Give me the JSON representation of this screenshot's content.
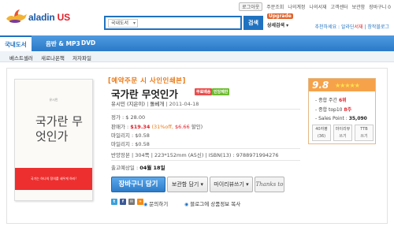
{
  "header": {
    "logo_brand": "aladin",
    "logo_us": "US",
    "top_links": [
      "로그아웃",
      "주문조회",
      "나의계정",
      "나의서재",
      "고객센터",
      "보관함",
      "장바구니 0"
    ],
    "search": {
      "category": "국내도서",
      "value": "",
      "button_label": "검색",
      "upgrade_label": "Upgrade",
      "detail_label": "상세검색 ▾"
    },
    "recommend_prefix": "추천하세요 : 알라딘",
    "recommend_highlight": "서재",
    "recommend_suffix": " | 창작블로그"
  },
  "nav": {
    "tabs": [
      "국내도서",
      "음반 & MP3",
      "DVD"
    ],
    "active_tab": "국내도서",
    "sub_items": [
      "베스트셀러",
      "새로나온책",
      "저자파일"
    ]
  },
  "book": {
    "preorder_label": "[예약주문 시 사인인쇄본]",
    "title": "국가란 무엇인가",
    "badges": [
      "무료배송",
      "인당제한"
    ],
    "author": "유시민 (지은이)",
    "publisher": "돌베개",
    "date": "2011-04-18",
    "cover_author": "유시민",
    "cover_title": "국가란 무엇인가",
    "cover_band_text": "국가는 하나의 정의를 세우게 하라!",
    "list_price_label": "정가 : ",
    "list_price": "$ 28.00",
    "sale_price_label": "판매가 : ",
    "sale_price": "$19.34",
    "discount": "(31%off,",
    "point_amount": "$6.66",
    "discount_suffix": "할인)",
    "mileage1_label": "마일리지 : ",
    "mileage1": "$0.58",
    "mileage2_label": "마일리지 : ",
    "mileage2": "$0.58",
    "specs": "반양장본 | 304쪽 | 223*152mm (A5신) | ISBN(13) : 9788971994276",
    "ship_prefix": "출고예상일 : ",
    "ship_value": "04월 18일"
  },
  "actions": {
    "cart": "장바구니 담기",
    "keep": "보관함 담기 ▾",
    "shelf": "마이리뷰쓰기 ▾",
    "thanks": "Thanks to",
    "share_label1": "문의하기",
    "share_label2": "블로그에 상품정보 복사"
  },
  "rating": {
    "score": "9.8",
    "stars": "★★★★★",
    "rank1_prefix": "종합 주간 ",
    "rank1_value": "6위",
    "rank2_prefix": "종합 top10 ",
    "rank2_value": "8주",
    "sales_label": "- Sales Point : ",
    "sales_value": "35,090",
    "buttons": [
      {
        "line1": "40자평",
        "line2": "(36)"
      },
      {
        "line1": "마이리뷰",
        "line2": "쓰기"
      },
      {
        "line1": "TTB",
        "line2": "쓰기"
      }
    ]
  }
}
